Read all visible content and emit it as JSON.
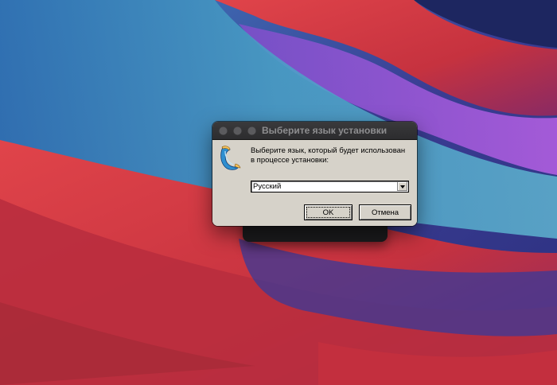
{
  "dialog": {
    "title": "Выберите язык установки",
    "prompt_line1": "Выберите язык, который будет использован",
    "prompt_line2": "в  процессе установки:",
    "language_select": {
      "selected": "Русский"
    },
    "ok_label": "OK",
    "cancel_label": "Отмена"
  },
  "colors": {
    "dialog_background": "#d6d2c9",
    "titlebar": "#2c2c2e",
    "title_text": "#8e8e90"
  },
  "icons": {
    "app": "installer-horn-icon",
    "dropdown": "chevron-down-icon"
  }
}
